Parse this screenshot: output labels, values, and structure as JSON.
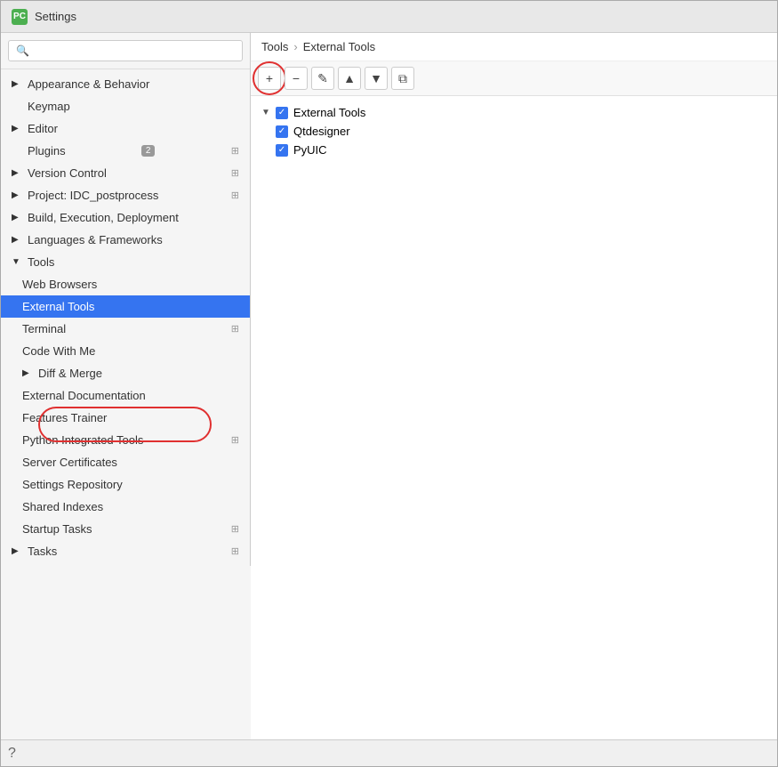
{
  "window": {
    "title": "Settings",
    "icon": "PC"
  },
  "search": {
    "placeholder": "🔍"
  },
  "sidebar": {
    "items": [
      {
        "id": "appearance",
        "label": "Appearance & Behavior",
        "indent": 0,
        "chevron": "▶",
        "has_settings": false,
        "badge": null
      },
      {
        "id": "keymap",
        "label": "Keymap",
        "indent": 0,
        "chevron": "",
        "has_settings": false,
        "badge": null
      },
      {
        "id": "editor",
        "label": "Editor",
        "indent": 0,
        "chevron": "▶",
        "has_settings": false,
        "badge": null
      },
      {
        "id": "plugins",
        "label": "Plugins",
        "indent": 0,
        "chevron": "",
        "has_settings": true,
        "badge": "2"
      },
      {
        "id": "version-control",
        "label": "Version Control",
        "indent": 0,
        "chevron": "▶",
        "has_settings": true,
        "badge": null
      },
      {
        "id": "project",
        "label": "Project: IDC_postprocess",
        "indent": 0,
        "chevron": "▶",
        "has_settings": true,
        "badge": null
      },
      {
        "id": "build",
        "label": "Build, Execution, Deployment",
        "indent": 0,
        "chevron": "▶",
        "has_settings": false,
        "badge": null
      },
      {
        "id": "languages",
        "label": "Languages & Frameworks",
        "indent": 0,
        "chevron": "▶",
        "has_settings": false,
        "badge": null
      },
      {
        "id": "tools",
        "label": "Tools",
        "indent": 0,
        "chevron": "▼",
        "has_settings": false,
        "badge": null,
        "expanded": true
      },
      {
        "id": "web-browsers",
        "label": "Web Browsers",
        "indent": 1,
        "chevron": "",
        "has_settings": false,
        "badge": null
      },
      {
        "id": "external-tools",
        "label": "External Tools",
        "indent": 1,
        "chevron": "",
        "has_settings": false,
        "badge": null,
        "active": true
      },
      {
        "id": "terminal",
        "label": "Terminal",
        "indent": 1,
        "chevron": "",
        "has_settings": true,
        "badge": null
      },
      {
        "id": "code-with-me",
        "label": "Code With Me",
        "indent": 1,
        "chevron": "",
        "has_settings": false,
        "badge": null
      },
      {
        "id": "diff-merge",
        "label": "Diff & Merge",
        "indent": 1,
        "chevron": "▶",
        "has_settings": false,
        "badge": null
      },
      {
        "id": "external-doc",
        "label": "External Documentation",
        "indent": 1,
        "chevron": "",
        "has_settings": false,
        "badge": null
      },
      {
        "id": "features-trainer",
        "label": "Features Trainer",
        "indent": 1,
        "chevron": "",
        "has_settings": false,
        "badge": null
      },
      {
        "id": "python-tools",
        "label": "Python Integrated Tools",
        "indent": 1,
        "chevron": "",
        "has_settings": true,
        "badge": null
      },
      {
        "id": "server-certs",
        "label": "Server Certificates",
        "indent": 1,
        "chevron": "",
        "has_settings": false,
        "badge": null
      },
      {
        "id": "settings-repo",
        "label": "Settings Repository",
        "indent": 1,
        "chevron": "",
        "has_settings": false,
        "badge": null
      },
      {
        "id": "shared-indexes",
        "label": "Shared Indexes",
        "indent": 1,
        "chevron": "",
        "has_settings": false,
        "badge": null
      },
      {
        "id": "startup-tasks",
        "label": "Startup Tasks",
        "indent": 1,
        "chevron": "",
        "has_settings": true,
        "badge": null
      },
      {
        "id": "tasks",
        "label": "Tasks",
        "indent": 0,
        "chevron": "▶",
        "has_settings": true,
        "badge": null
      }
    ]
  },
  "breadcrumb": {
    "root": "Tools",
    "separator": "›",
    "current": "External Tools"
  },
  "toolbar": {
    "add": "+",
    "remove": "−",
    "edit": "✎",
    "up": "▲",
    "down": "▼",
    "copy": "⧉"
  },
  "tree": {
    "items": [
      {
        "id": "external-tools-group",
        "label": "External Tools",
        "indent": 0,
        "checked": true,
        "chevron": "▼"
      },
      {
        "id": "qtdesigner",
        "label": "Qtdesigner",
        "indent": 1,
        "checked": true,
        "chevron": ""
      },
      {
        "id": "pyuic",
        "label": "PyUIC",
        "indent": 1,
        "checked": true,
        "chevron": ""
      }
    ]
  }
}
